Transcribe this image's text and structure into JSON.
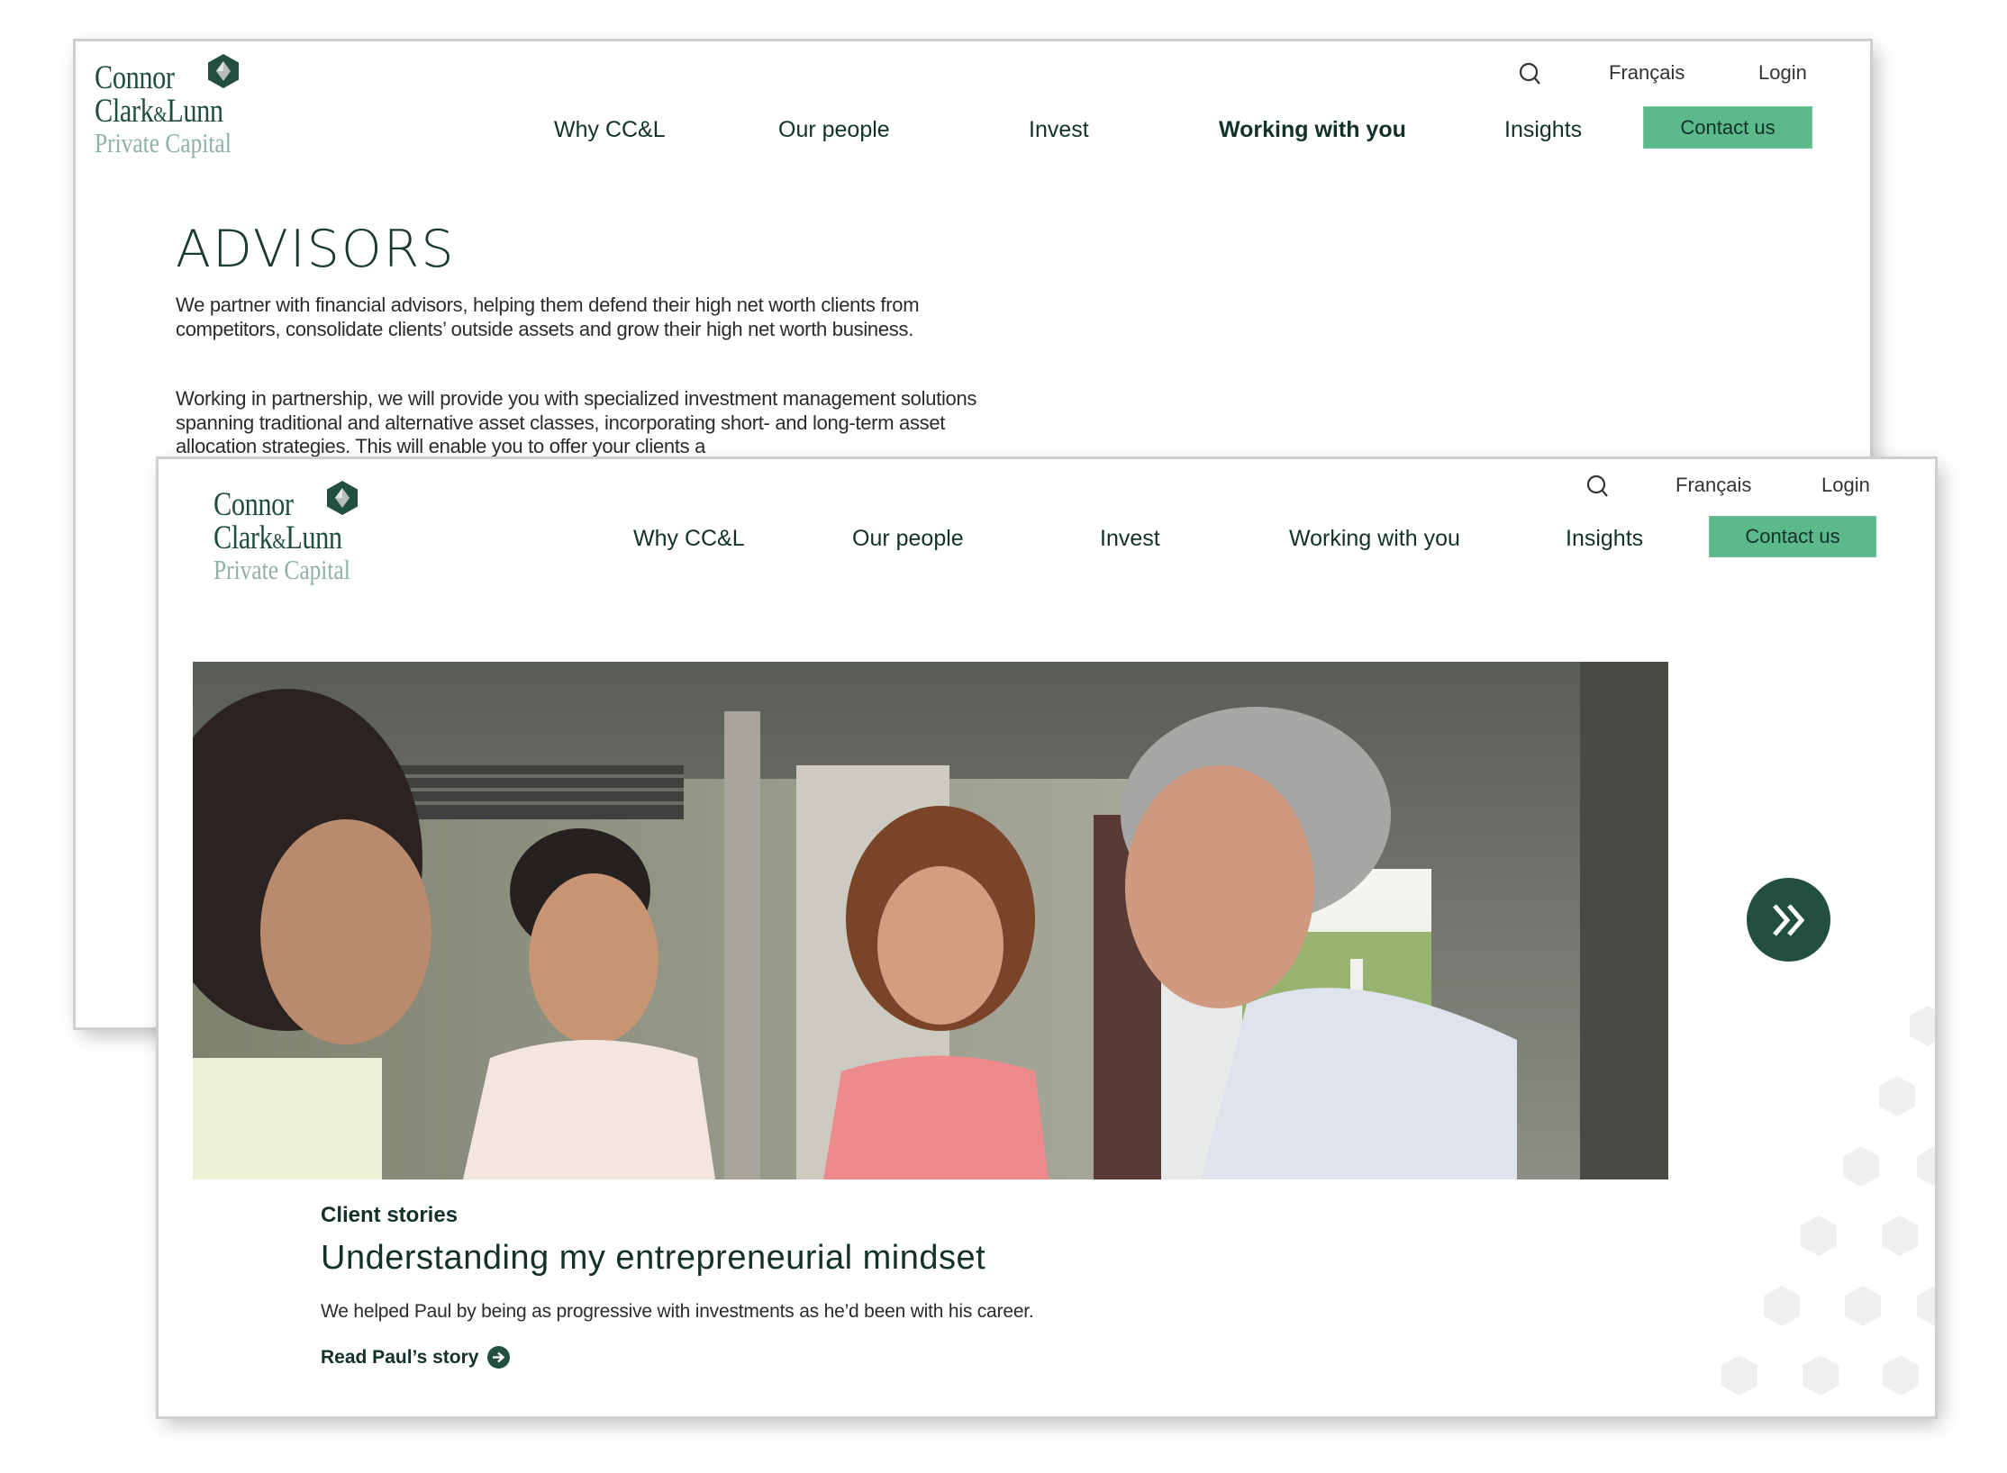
{
  "brand": {
    "line1": "Connor",
    "line2a": "Clark",
    "line2amp": "&",
    "line2b": "Lunn",
    "line3": "Private Capital",
    "colors": {
      "primary": "#234f40",
      "accent": "#5bb98a",
      "logo_sub": "#8fb0a3"
    }
  },
  "nav": {
    "items": [
      "Why CC&L",
      "Our people",
      "Invest",
      "Working with you",
      "Insights"
    ],
    "search_icon": "search-icon",
    "language": "Français",
    "login": "Login",
    "contact": "Contact us"
  },
  "back_page": {
    "active_nav": "Working with you",
    "title": "ADVISORS",
    "paragraphs": [
      "We partner with financial advisors, helping them defend their high net worth clients from competitors, consolidate clients’ outside assets and grow their high net worth business.",
      "Working in partnership, we will provide you with specialized investment management solutions spanning traditional and alternative asset classes, incorporating short- and long-term asset allocation strategies. This will enable you to offer your clients a"
    ]
  },
  "front_page": {
    "hero": {
      "image_alt": "Four people smiling and talking around an outdoor table",
      "next_icon": "double-chevron-right-icon"
    },
    "story": {
      "eyebrow": "Client stories",
      "title": "Understanding my entrepreneurial mindset",
      "description": "We helped Paul by being as progressive with investments as he’d been with his career.",
      "link": "Read Paul’s story",
      "link_icon": "arrow-right-circle-icon"
    }
  }
}
